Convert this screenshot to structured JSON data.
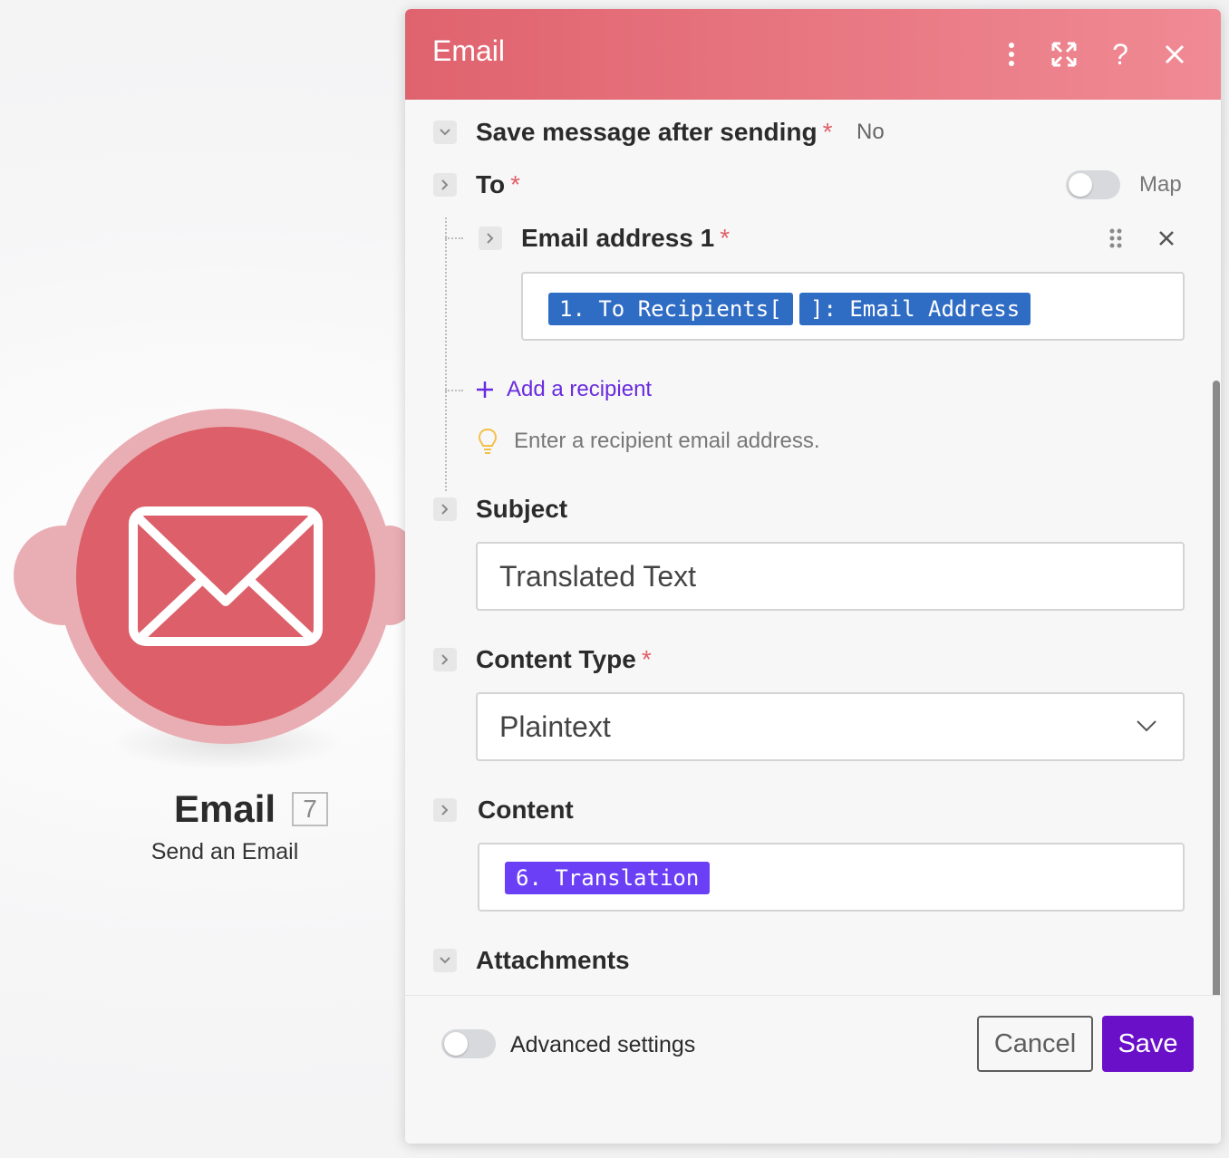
{
  "module": {
    "title": "Email",
    "badge": "7",
    "subtitle": "Send an Email",
    "icon": "envelope-icon"
  },
  "panel": {
    "title": "Email",
    "header_icons": [
      "more-vertical-icon",
      "maximize-icon",
      "help-icon",
      "close-icon"
    ]
  },
  "fields": {
    "save_message": {
      "label": "Save message after sending",
      "required_mark": "*",
      "value": "No"
    },
    "to": {
      "label": "To",
      "required_mark": "*",
      "map_label": "Map",
      "map_enabled": false
    },
    "email_address": {
      "label": "Email address 1",
      "required_mark": "*",
      "pills": [
        "1. To Recipients[",
        "]: Email Address"
      ]
    },
    "add_recipient": "Add a recipient",
    "hint": "Enter a recipient email address.",
    "subject": {
      "label": "Subject",
      "value": "Translated Text"
    },
    "content_type": {
      "label": "Content Type",
      "required_mark": "*",
      "value": "Plaintext"
    },
    "content": {
      "label": "Content",
      "pill": "6. Translation"
    },
    "attachments": {
      "label": "Attachments"
    }
  },
  "footer": {
    "advanced_label": "Advanced settings",
    "advanced_enabled": false,
    "cancel": "Cancel",
    "save": "Save"
  },
  "colors": {
    "header_start": "#df636e",
    "header_end": "#f08a94",
    "pill_blue": "#2f6cc4",
    "pill_violet": "#6b3ff5",
    "save_button": "#6a10c9",
    "link": "#6a2be0",
    "required": "#e25f69"
  }
}
